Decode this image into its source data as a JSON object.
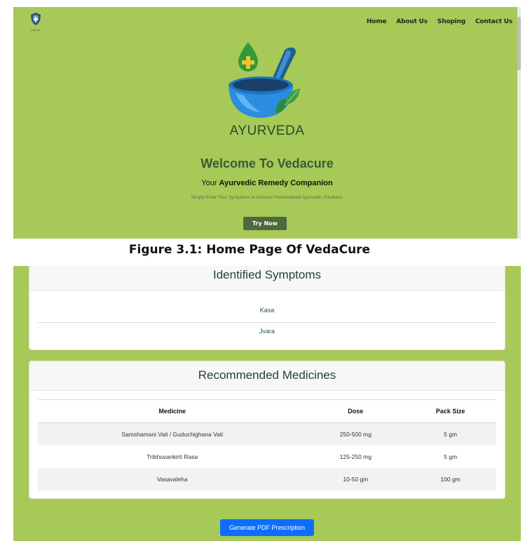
{
  "home": {
    "logo_text": "Veda Cure",
    "nav": [
      "Home",
      "About Us",
      "Shoping",
      "Contact Us"
    ],
    "hero_wordmark": "AYURVEDA",
    "title": "Welcome To Vedacure",
    "subtitle_prefix": "Your",
    "subtitle_bold": "Ayurvedic Remedy Companion",
    "description": "Simply Enter Your Symptoms to Uncover Personalized Ayurvedic Solutions.",
    "cta_label": "Try Now"
  },
  "caption": "Figure 3.1: Home Page Of VedaCure",
  "results": {
    "symptoms_title": "Identified Symptoms",
    "symptoms": [
      "Kasa",
      "Jvara"
    ],
    "medicines_title": "Recommended Medicines",
    "table_headers": [
      "Medicine",
      "Dose",
      "Pack Size"
    ],
    "medicines": [
      {
        "name": "Samshamani Vati / Guduchighana Vati",
        "dose": "250-500 mg",
        "pack": "5 gm"
      },
      {
        "name": "Tribhuvankirti Rasa",
        "dose": "125-250 mg",
        "pack": "5 gm"
      },
      {
        "name": "Vasavaleha",
        "dose": "10-50 gm",
        "pack": "100 gm"
      }
    ],
    "pdf_button": "Generate PDF Prescription"
  },
  "colors": {
    "page_green": "#a7c957",
    "title_green": "#3a5a37",
    "button_dark_green": "#4c6a3c",
    "primary_blue": "#0d6efd"
  }
}
